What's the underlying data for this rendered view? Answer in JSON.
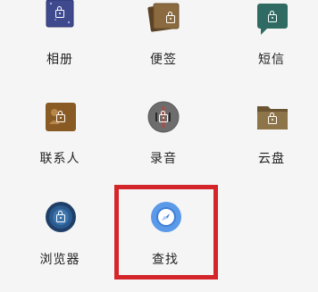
{
  "apps": [
    {
      "id": "album",
      "label": "相册",
      "icon": "album-icon",
      "color": "#3f4a8e"
    },
    {
      "id": "notes",
      "label": "便签",
      "icon": "notes-icon",
      "color": "#7a5a34"
    },
    {
      "id": "messages",
      "label": "短信",
      "icon": "messages-icon",
      "color": "#2f6b63"
    },
    {
      "id": "contacts",
      "label": "联系人",
      "icon": "contacts-icon",
      "color": "#8a5a24"
    },
    {
      "id": "recorder",
      "label": "录音",
      "icon": "recorder-icon",
      "color": "#6d6d6d"
    },
    {
      "id": "cloud",
      "label": "云盘",
      "icon": "cloud-folder-icon",
      "color": "#7e6540"
    },
    {
      "id": "browser",
      "label": "浏览器",
      "icon": "browser-icon",
      "color": "#24507e"
    },
    {
      "id": "find",
      "label": "查找",
      "icon": "find-compass-icon",
      "color": "#5a9ae8"
    }
  ],
  "highlight": {
    "target": "查找",
    "color": "#d4252b"
  }
}
